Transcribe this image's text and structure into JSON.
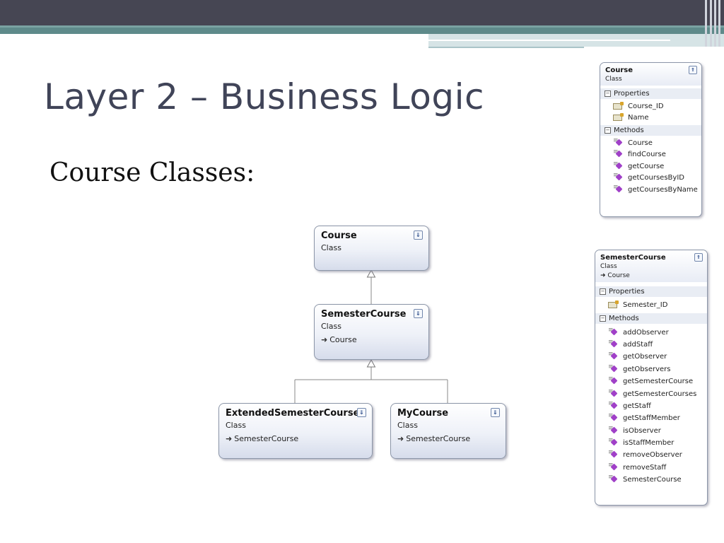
{
  "slide": {
    "title": "Layer 2 – Business Logic",
    "subtitle": "Course Classes:"
  },
  "diagram": {
    "course": {
      "name": "Course",
      "stereotype": "Class"
    },
    "semester": {
      "name": "SemesterCourse",
      "stereotype": "Class",
      "base": "Course"
    },
    "extended": {
      "name": "ExtendedSemesterCourse",
      "stereotype": "Class",
      "base": "SemesterCourse"
    },
    "mycourse": {
      "name": "MyCourse",
      "stereotype": "Class",
      "base": "SemesterCourse"
    },
    "expand_icon": "double-chevron-down-icon"
  },
  "course_detail": {
    "name": "Course",
    "stereotype": "Class",
    "properties_label": "Properties",
    "properties": [
      "Course_ID",
      "Name"
    ],
    "methods_label": "Methods",
    "methods": [
      "Course",
      "findCourse",
      "getCourse",
      "getCoursesByID",
      "getCoursesByName"
    ],
    "collapse_icon": "double-chevron-up-icon"
  },
  "semester_detail": {
    "name": "SemesterCourse",
    "stereotype": "Class",
    "base": "Course",
    "properties_label": "Properties",
    "properties": [
      "Semester_ID"
    ],
    "methods_label": "Methods",
    "methods": [
      "addObserver",
      "addStaff",
      "getObserver",
      "getObservers",
      "getSemesterCourse",
      "getSemesterCourses",
      "getStaff",
      "getStaffMember",
      "isObserver",
      "isStaffMember",
      "removeObserver",
      "removeStaff",
      "SemesterCourse"
    ],
    "collapse_icon": "double-chevron-up-icon"
  },
  "colors": {
    "header_dark": "#464653",
    "header_teal": "#5e8a8a",
    "title_text": "#404458",
    "method_icon": "#a040c8"
  }
}
